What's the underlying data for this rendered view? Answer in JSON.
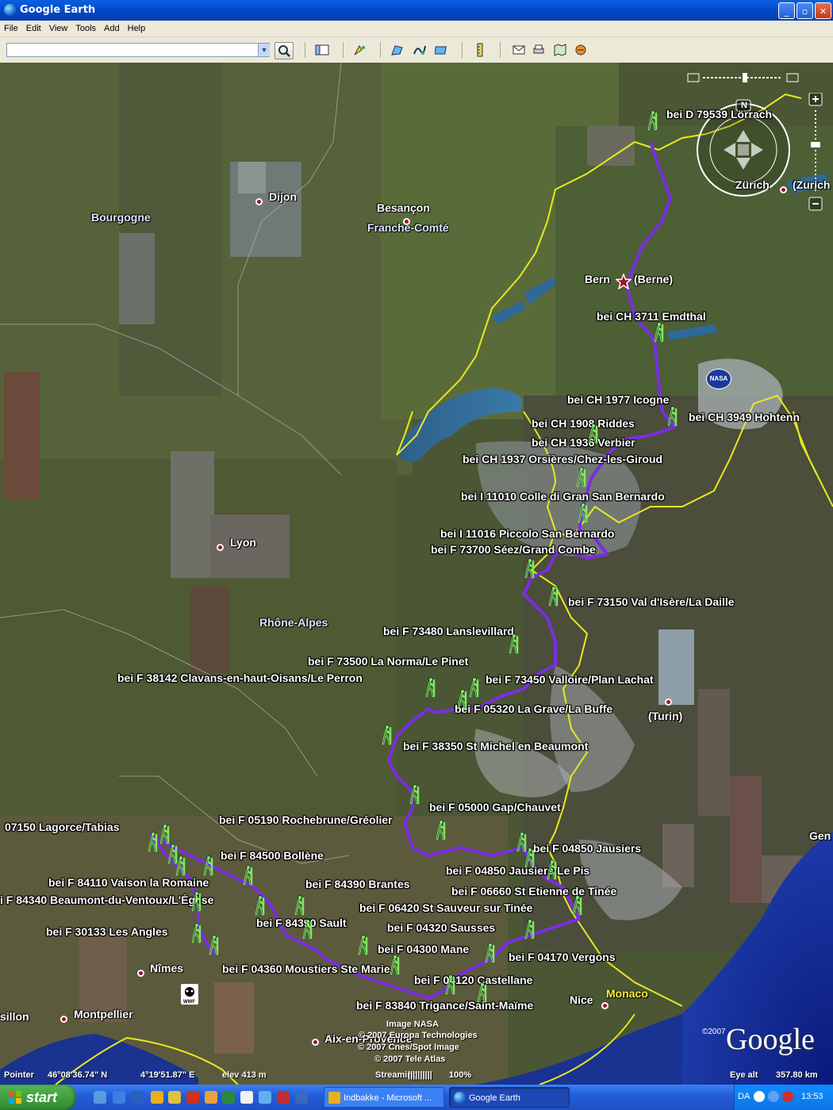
{
  "window": {
    "title": "Google Earth",
    "min": "_",
    "max": "▫",
    "close": "✕"
  },
  "menu": [
    "File",
    "Edit",
    "View",
    "Tools",
    "Add",
    "Help"
  ],
  "search": {
    "value": "",
    "placeholder": ""
  },
  "colors": {
    "route": "#7a2ee0",
    "border": "#e8e820",
    "titlebar": "#0a5fe0"
  },
  "map": {
    "cities": {
      "dijon": "Dijon",
      "besancon": "Besançon",
      "lyon": "Lyon",
      "bern": "Bern",
      "berne": "(Berne)",
      "zurich": "Zürich",
      "zurich2": "(Zurich",
      "turin": "(Turin)",
      "nimes": "Nîmes",
      "montpellier": "Montpellier",
      "nice": "Nice",
      "monaco": "Monaco",
      "aix": "Aix-en-Provence",
      "gen": "Gen",
      "sillon": "sillon"
    },
    "regions": {
      "bourgogne": "Bourgogne",
      "franche": "Franche-Comté",
      "rhone": "Rhône-Alpes"
    },
    "waypoints": [
      "bei D 79539 Lörrach",
      "bei CH 3711 Emdthal",
      "bei CH 1977 Icogne",
      "bei CH 3949 Hohtenn",
      "bei CH 1908 Riddes",
      "bei CH 1936 Verbier",
      "bei CH 1937 Orsières/Chez-les-Giroud",
      "bei I 11010 Colle di Gran San Bernardo",
      "bei I 11016 Piccolo San Bernardo",
      "bei F 73700 Séez/Grand Combe",
      "bei F 73150 Val d'Isère/La Daille",
      "bei F 73480 Lanslevillard",
      "bei F 73500 La Norma/Le Pinet",
      "bei F 38142 Clavans-en-haut-Oisans/Le Perron",
      "bei F 73450 Valloire/Plan Lachat",
      "bei F 05320 La Grave/La Buffe",
      "bei F 38350 St Michel en Beaumont",
      "bei F 05000 Gap/Chauvet",
      "bei F 05190 Rochebrune/Gréolier",
      "07150 Lagorce/Tabias",
      "bei F 04850 Jausiers",
      "bei F 84500 Bollène",
      "bei F 04850 Jausiers/Le Pis",
      "bei F 84110 Vaison la Romaine",
      "bei F 84390 Brantes",
      "bei F 06660 St Etienne de Tinée",
      "i F 84340 Beaumont-du-Ventoux/L'Église",
      "bei F 06420 St Sauveur sur Tinée",
      "bei F 84390 Sault",
      "bei F 04320 Sausses",
      "bei F 30133 Les Angles",
      "bei F 04300 Mane",
      "bei F 04170 Vergons",
      "bei F 04360 Moustiers Ste Marie",
      "bei F 04120 Castellane",
      "bei F 83840 Trigance/Saint-Maïme"
    ],
    "credits": [
      "Image NASA",
      "© 2007 Europa Technologies",
      "© 2007 Cnes/Spot Image",
      "© 2007 Tele Atlas"
    ],
    "google": "Google",
    "google_copy": "©2007",
    "compass_n": "N",
    "nasa": "NASA"
  },
  "statusbar": {
    "pointer_label": "Pointer",
    "lat": "46°08'36.74\" N",
    "lon": "4°19'51.87\" E",
    "elev": "elev   413 m",
    "streaming": "Streaming",
    "streaming_bars": "||||||||||",
    "streaming_pct": "100%",
    "eye_label": "Eye alt",
    "eye_value": "357.80 km"
  },
  "taskbar": {
    "start": "start",
    "items": [
      "Indbakke - Microsoft ...",
      "Google Earth"
    ],
    "lang": "DA",
    "clock": "13:53"
  }
}
